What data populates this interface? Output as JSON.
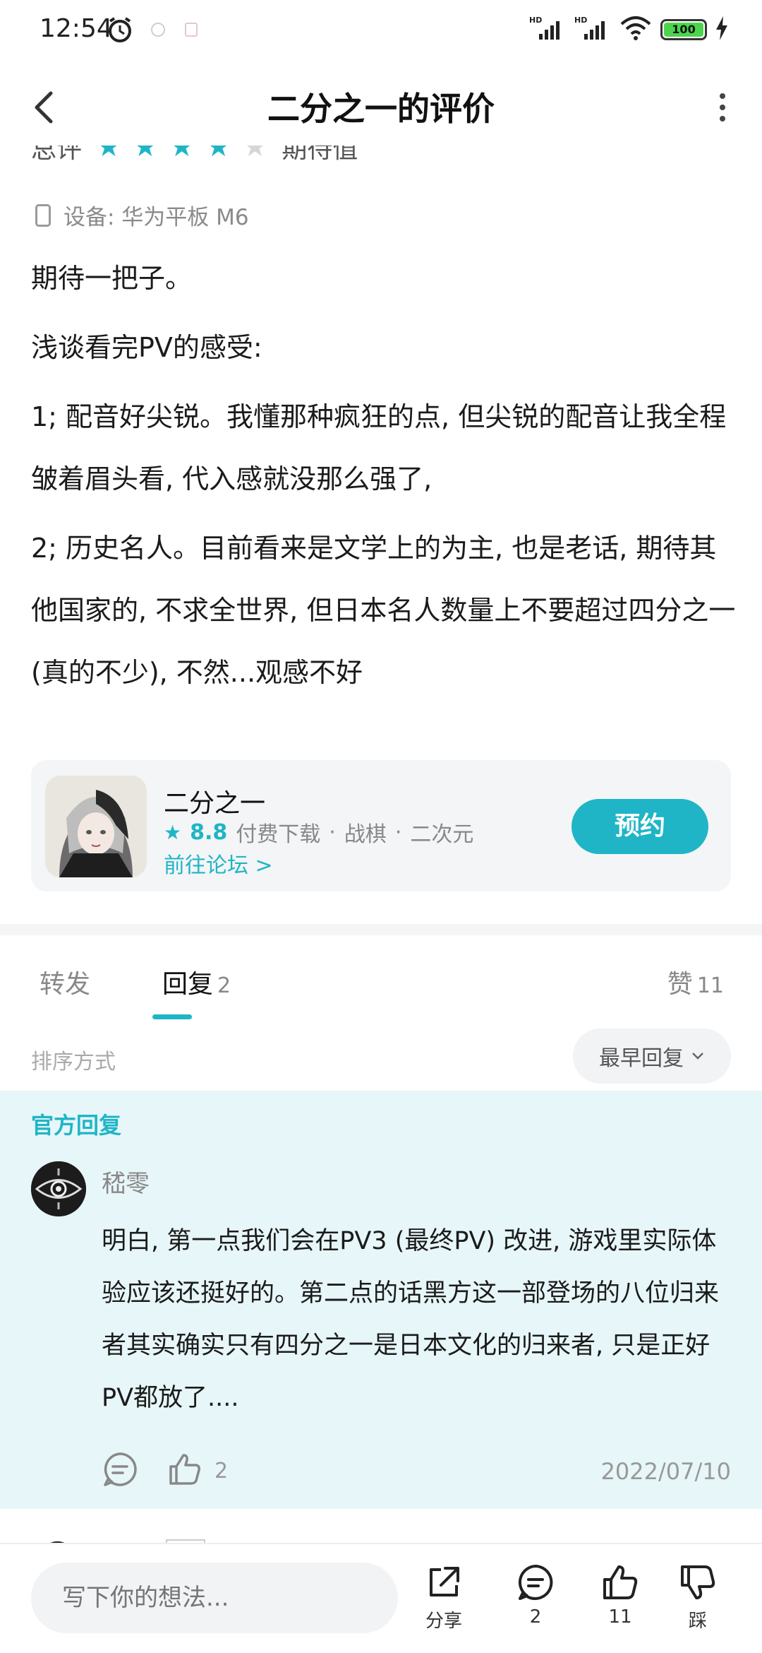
{
  "status_bar": {
    "time": "12:54",
    "battery": "100",
    "signal1": "HD",
    "signal2": "HD"
  },
  "nav": {
    "title": "二分之一的评价"
  },
  "review": {
    "rating_label": "总评",
    "rating_stars": 4,
    "rating_suffix": "期待值",
    "device": "设备: 华为平板 M6",
    "paragraphs": [
      "期待一把子。",
      "浅谈看完PV的感受:",
      "1; 配音好尖锐。我懂那种疯狂的点, 但尖锐的配音让我全程皱着眉头看, 代入感就没那么强了,",
      "2; 历史名人。目前看来是文学上的为主, 也是老话, 期待其他国家的, 不求全世界, 但日本名人数量上不要超过四分之一 (真的不少), 不然...观感不好"
    ]
  },
  "game_card": {
    "name": "二分之一",
    "score": "8.8",
    "tag1": "付费下载",
    "tag2": "战棋",
    "tag3": "二次元",
    "sep": "·",
    "forum_link": "前往论坛 >",
    "reserve_label": "预约"
  },
  "tabs": {
    "forward": "转发",
    "reply": "回复",
    "reply_count": "2",
    "likes": "赞",
    "likes_count": "11"
  },
  "sort": {
    "label": "排序方式",
    "value": "最早回复"
  },
  "official_reply": {
    "label": "官方回复",
    "user": "嵇零",
    "text": "明白, 第一点我们会在PV3 (最终PV) 改进, 游戏里实际体验应该还挺好的。第二点的话黑方这一部登场的八位归来者其实确实只有四分之一是日本文化的归来者, 只是正好PV都放了....",
    "like_count": "2",
    "date": "2022/07/10"
  },
  "bottom_bar": {
    "input_placeholder": "写下你的想法...",
    "share_label": "分享",
    "comment_count": "2",
    "like_count": "11",
    "dislike_label": "踩"
  },
  "colors": {
    "accent": "#1fb5c6",
    "official_bg": "#e7f6f8"
  }
}
